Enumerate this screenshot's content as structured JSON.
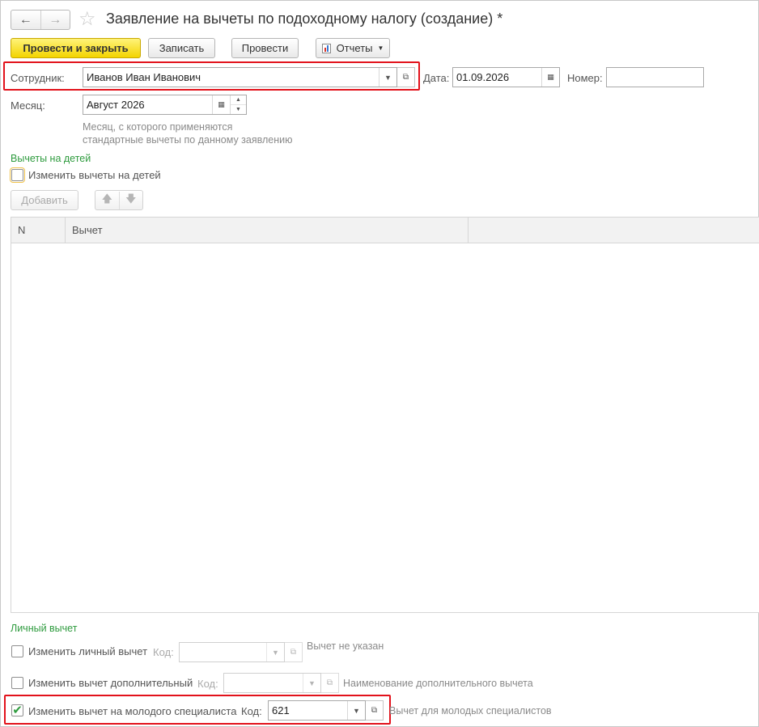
{
  "window": {
    "title": "Заявление на вычеты по подоходному налогу (создание) *"
  },
  "nav": {
    "back_icon": "arrow-left-icon",
    "forward_icon": "arrow-right-icon",
    "star_icon": "star-icon"
  },
  "toolbar": {
    "post_close_label": "Провести и закрыть",
    "save_label": "Записать",
    "post_label": "Провести",
    "reports_label": "Отчеты"
  },
  "form": {
    "employee_label": "Сотрудник:",
    "employee_value": "Иванов Иван Иванович",
    "date_label": "Дата:",
    "date_value": "01.09.2026",
    "number_label": "Номер:",
    "number_value": "",
    "month_label": "Месяц:",
    "month_value": "Август 2026",
    "month_hint_line1": "Месяц, с которого применяются",
    "month_hint_line2": "стандартные вычеты по данному заявлению"
  },
  "children": {
    "section_title": "Вычеты на детей",
    "change_label": "Изменить вычеты на детей",
    "change_checked": false,
    "add_label": "Добавить",
    "table_headers": [
      "N",
      "Вычет"
    ],
    "rows": []
  },
  "personal": {
    "section_title": "Личный вычет",
    "personal_label": "Изменить личный вычет",
    "personal_checked": false,
    "personal_code_label": "Код:",
    "personal_code_value": "",
    "personal_desc": "Вычет не указан",
    "additional_label": "Изменить вычет дополнительный",
    "additional_checked": false,
    "additional_code_label": "Код:",
    "additional_code_value": "",
    "additional_desc": "Наименование дополнительного вычета",
    "young_label": "Изменить вычет на молодого специалиста",
    "young_checked": true,
    "young_code_label": "Код:",
    "young_code_value": "621",
    "young_desc": "Вычет для молодых специалистов"
  },
  "colors": {
    "accent_green": "#2e9b3e",
    "highlight_red": "#e2121b",
    "primary_yellow": "#f3d400"
  }
}
